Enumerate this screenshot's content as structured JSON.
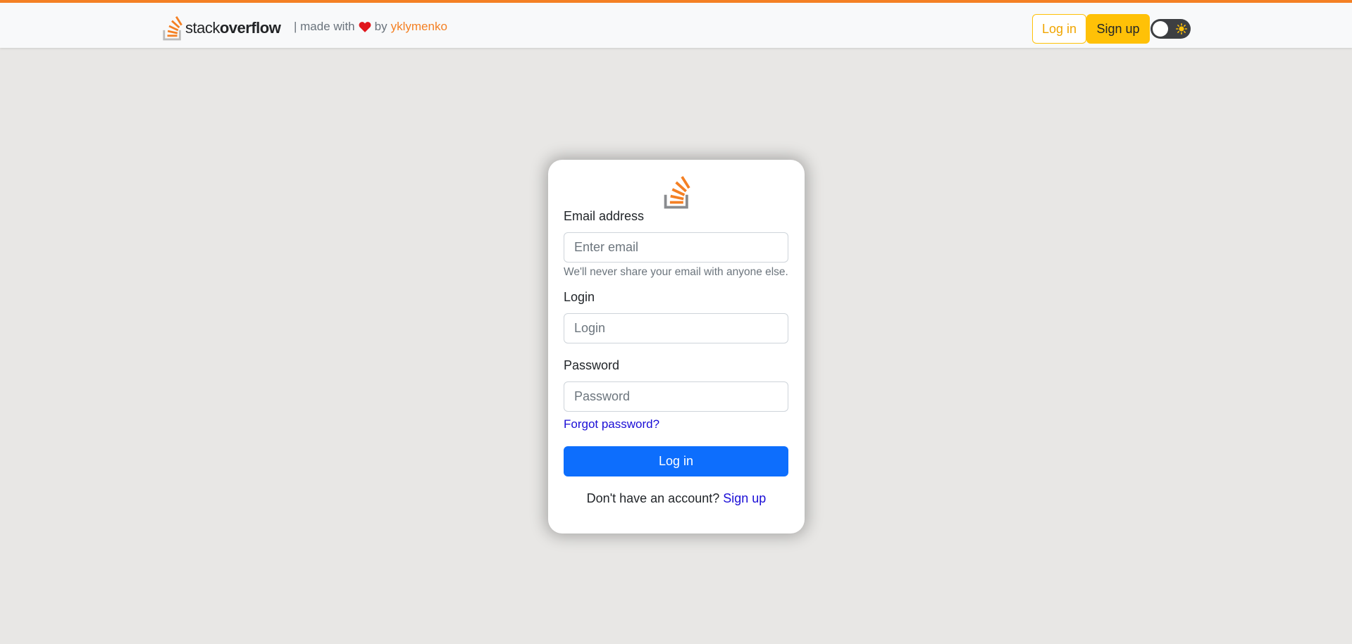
{
  "header": {
    "logo_icon": "stackoverflow-logo-icon",
    "wordmark_light": "stack",
    "wordmark_bold": "overflow",
    "made_with_prefix": "| made with",
    "heart_icon": "heart-icon",
    "by_text": "by",
    "author": "yklymenko",
    "login_label": "Log in",
    "signup_label": "Sign up",
    "theme_toggle_icon": "sun-icon"
  },
  "form": {
    "logo_icon": "stackoverflow-logo-icon",
    "email_label": "Email address",
    "email_placeholder": "Enter email",
    "email_value": "",
    "email_help": "We'll never share your email with anyone else.",
    "login_label": "Login",
    "login_placeholder": "Login",
    "login_value": "",
    "password_label": "Password",
    "password_placeholder": "Password",
    "password_value": "",
    "forgot_password": "Forgot password?",
    "submit_label": "Log in",
    "no_account_text": "Don't have an account?",
    "signup_link": "Sign up"
  },
  "colors": {
    "accent_orange": "#f48024",
    "warning_yellow": "#ffc107",
    "primary_blue": "#0d6efd",
    "link_blue": "#1a0dd6",
    "background": "#e8e7e5"
  }
}
